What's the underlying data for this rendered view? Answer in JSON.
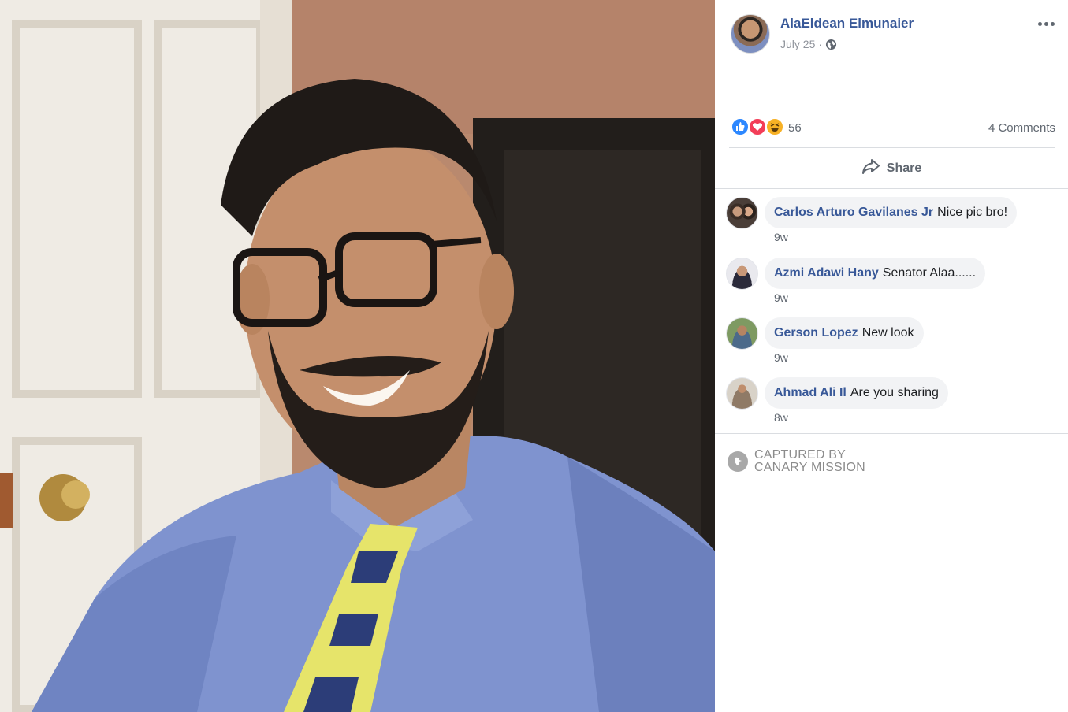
{
  "post": {
    "author": "AlaEldean Elmunaier",
    "date": "July 25",
    "separator": "·",
    "privacy_icon": "globe-icon",
    "more_icon": "more-options-icon"
  },
  "reactions": {
    "types": [
      "like",
      "love",
      "haha"
    ],
    "count": "56",
    "comments_count": "4 Comments"
  },
  "actions": {
    "share_label": "Share"
  },
  "comments": [
    {
      "author": "Carlos Arturo Gavilanes Jr",
      "text": "Nice pic bro!",
      "time": "9w"
    },
    {
      "author": "Azmi Adawi Hany",
      "text": "Senator Alaa......",
      "time": "9w"
    },
    {
      "author": "Gerson Lopez",
      "text": "New look",
      "time": "9w"
    },
    {
      "author": "Ahmad Ali Il",
      "text": "Are you sharing",
      "time": "8w"
    }
  ],
  "watermark": {
    "line1": "CAPTURED BY",
    "line2": "CANARY MISSION"
  },
  "colors": {
    "link": "#385898",
    "secondary_text": "#606770",
    "bubble": "#f2f3f5",
    "like": "#2d88ff",
    "love": "#f33e58",
    "haha": "#f7b125"
  }
}
